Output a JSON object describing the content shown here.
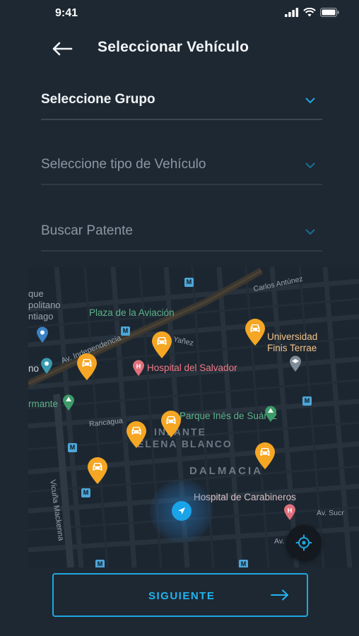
{
  "status_bar": {
    "time": "9:41"
  },
  "header": {
    "title": "Seleccionar Vehículo"
  },
  "fields": {
    "group": {
      "label": "Seleccione Grupo"
    },
    "vehicle_type": {
      "label": "Seleccione tipo de Vehículo"
    },
    "plate": {
      "label": "Buscar Patente"
    }
  },
  "map": {
    "labels": {
      "que": "que",
      "politano": "politano",
      "ntiago": "ntiago",
      "plaza": "Plaza de la Aviación",
      "avenida": "Av. Independencia",
      "yanez": "Yañez",
      "hospital_salvador": "Hospital del Salvador",
      "universidad": "Universidad",
      "finis_terrae": "Finis Terrae",
      "carlos_antunez": "Carlos Antúnez",
      "no": "no",
      "rmante": "rmante",
      "rancagua": "Rancagua",
      "parque_ines": "Parque Inés de Suárez",
      "infante": "INFANTE",
      "elena_blanco": "ELENA BLANCO",
      "dalmacia": "DALMACIA",
      "hospital_carabineros": "Hospital de Carabineros",
      "vicuna_mackenna": "Vicuña Mackenna",
      "av_sucre": "Av. Sucr",
      "av_sim": "Av. Sim"
    },
    "pin_icon": "car-icon",
    "pin_color": "#f5a623"
  },
  "next_button": {
    "label": "SIGUIENTE"
  },
  "colors": {
    "accent": "#1fa7e0",
    "background": "#1e2832",
    "pin": "#f5a623"
  }
}
